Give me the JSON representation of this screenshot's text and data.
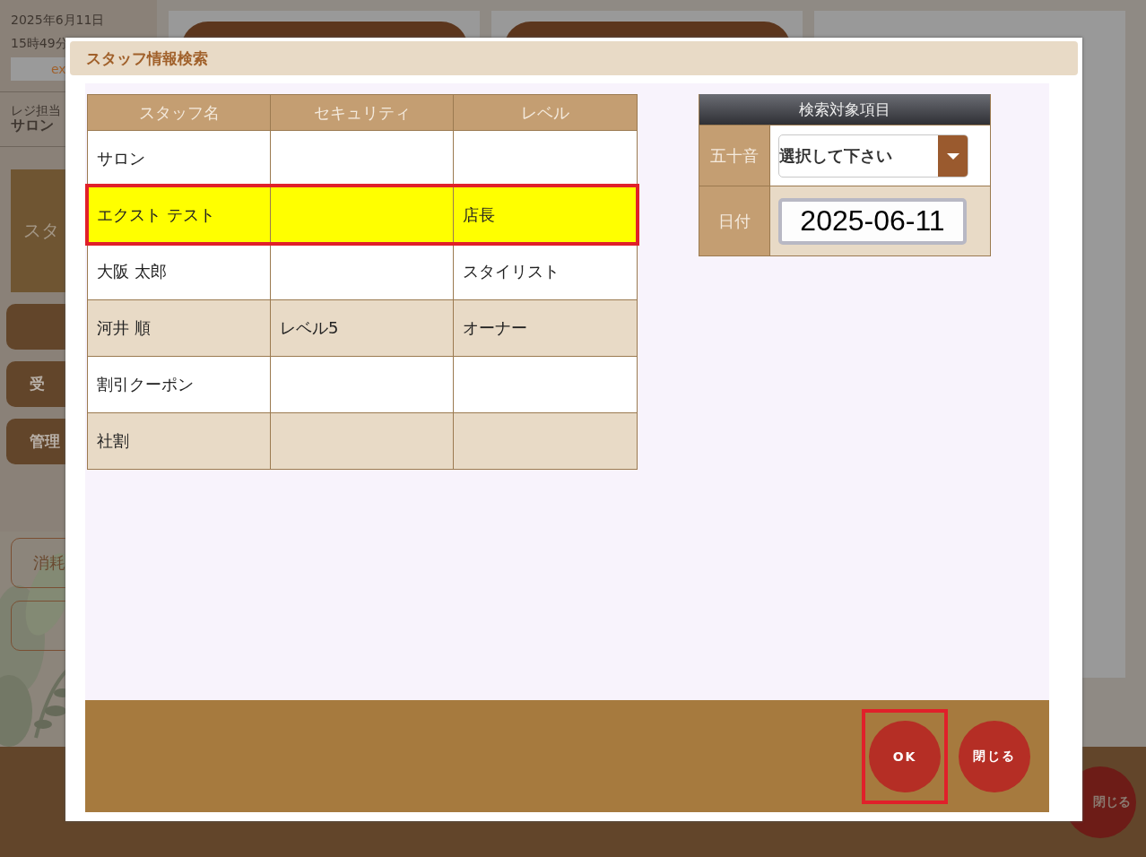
{
  "background": {
    "date": "2025年6月11日",
    "time": "15時49分",
    "user_code": "ex",
    "cashier_label": "レジ担当",
    "cashier_name": "サロン",
    "side_items": [
      {
        "kind": "panel",
        "label": "スタ"
      },
      {
        "kind": "filled"
      },
      {
        "kind": "filled",
        "label": "受"
      },
      {
        "kind": "filled",
        "label": "管理"
      },
      {
        "kind": "outline",
        "label": "消耗"
      },
      {
        "kind": "outline"
      }
    ],
    "close_button": "閉じる"
  },
  "dialog": {
    "title": "スタッフ情報検索",
    "table": {
      "columns": [
        "スタッフ名",
        "セキュリティ",
        "レベル"
      ],
      "rows": [
        {
          "cells": [
            "サロン",
            "",
            ""
          ],
          "selected": false
        },
        {
          "cells": [
            "エクスト テスト",
            "",
            "店長"
          ],
          "selected": true
        },
        {
          "cells": [
            "大阪 太郎",
            "",
            "スタイリスト"
          ],
          "selected": false
        },
        {
          "cells": [
            "河井 順",
            "レベル5",
            "オーナー"
          ],
          "selected": false
        },
        {
          "cells": [
            "割引クーポン",
            "",
            ""
          ],
          "selected": false
        },
        {
          "cells": [
            "社割",
            "",
            ""
          ],
          "selected": false
        }
      ]
    },
    "search_panel": {
      "title": "検索対象項目",
      "fields": [
        {
          "kind": "select",
          "label": "五十音",
          "value": "選択して下さい"
        },
        {
          "kind": "date",
          "label": "日付",
          "value": "2025-06-11"
        }
      ]
    },
    "buttons": [
      {
        "label": "OK",
        "highlighted": true
      },
      {
        "label": "閉じる",
        "highlighted": false
      }
    ]
  }
}
